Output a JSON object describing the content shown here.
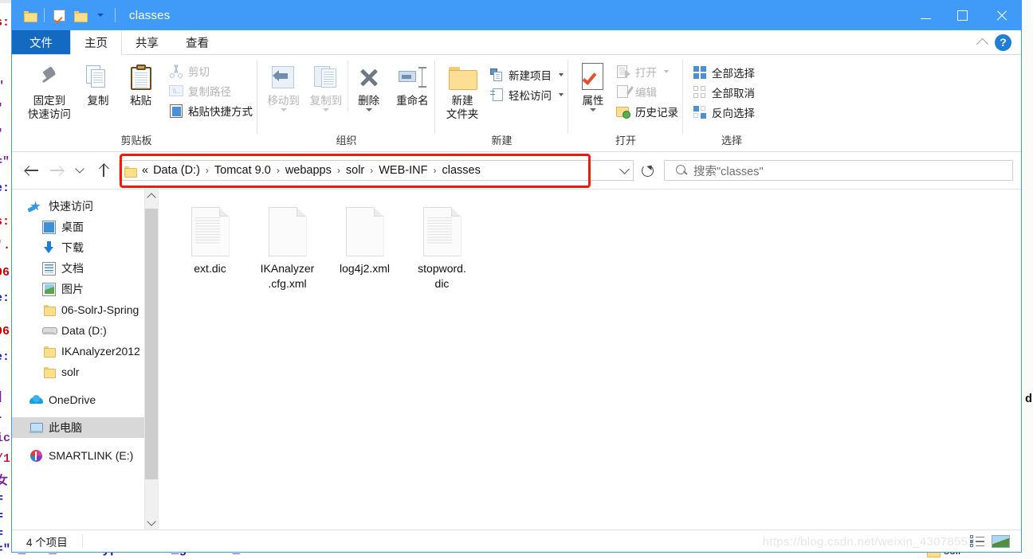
{
  "window": {
    "title": "classes",
    "quick_access_icons": [
      "folder-icon",
      "properties-check-icon",
      "folder-icon"
    ],
    "dropdown_caret": "chevron-down-icon",
    "minimize": "minimize-icon",
    "maximize": "maximize-icon",
    "close": "close-icon"
  },
  "ribbon": {
    "tabs": [
      {
        "label": "文件",
        "type": "file"
      },
      {
        "label": "主页",
        "type": "active"
      },
      {
        "label": "共享",
        "type": "normal"
      },
      {
        "label": "查看",
        "type": "normal"
      }
    ],
    "collapse_icon": "chevron-up-icon",
    "help_icon": "question-mark-icon",
    "groups": [
      {
        "label": "剪贴板",
        "big_buttons": [
          {
            "label": "固定到\n快速访问",
            "line1": "固定到",
            "line2": "快速访问",
            "icon": "pin-icon"
          },
          {
            "label": "复制",
            "line1": "复制",
            "line2": "",
            "icon": "copy-icon"
          },
          {
            "label": "粘贴",
            "line1": "粘贴",
            "line2": "",
            "icon": "paste-clipboard-icon"
          }
        ],
        "small_buttons": [
          {
            "label": "剪切",
            "icon": "scissors-icon",
            "disabled": true
          },
          {
            "label": "复制路径",
            "icon": "copy-path-icon",
            "disabled": true
          },
          {
            "label": "粘贴快捷方式",
            "icon": "paste-shortcut-icon",
            "disabled": false
          }
        ]
      },
      {
        "label": "组织",
        "big_buttons": [
          {
            "line1": "移动到",
            "line2": "",
            "icon": "move-to-icon",
            "disabled": true,
            "caret": true
          },
          {
            "line1": "复制到",
            "line2": "",
            "icon": "copy-to-icon",
            "disabled": true,
            "caret": true
          },
          {
            "line1": "删除",
            "line2": "",
            "icon": "delete-x-icon",
            "disabled": false,
            "caret": true
          },
          {
            "line1": "重命名",
            "line2": "",
            "icon": "rename-icon",
            "disabled": false,
            "caret": false
          }
        ],
        "small_buttons": []
      },
      {
        "label": "新建",
        "big_buttons": [
          {
            "line1": "新建",
            "line2": "文件夹",
            "icon": "new-folder-icon"
          }
        ],
        "small_buttons": [
          {
            "label": "新建项目",
            "icon": "new-item-icon",
            "caret": true
          },
          {
            "label": "轻松访问",
            "icon": "easy-access-icon",
            "caret": true
          }
        ]
      },
      {
        "label": "打开",
        "big_buttons": [
          {
            "line1": "属性",
            "line2": "",
            "icon": "properties-icon",
            "caret": true
          }
        ],
        "small_buttons": [
          {
            "label": "打开",
            "icon": "open-icon",
            "disabled": true,
            "caret": true
          },
          {
            "label": "编辑",
            "icon": "edit-icon",
            "disabled": true
          },
          {
            "label": "历史记录",
            "icon": "history-icon",
            "disabled": false
          }
        ]
      },
      {
        "label": "选择",
        "big_buttons": [],
        "small_buttons": [
          {
            "label": "全部选择",
            "icon": "select-all-icon"
          },
          {
            "label": "全部取消",
            "icon": "select-none-icon"
          },
          {
            "label": "反向选择",
            "icon": "invert-selection-icon"
          }
        ]
      }
    ]
  },
  "addressbar": {
    "back_icon": "back-arrow-icon",
    "forward_icon": "forward-arrow-icon",
    "recent_icon": "chevron-down-icon",
    "up_icon": "up-arrow-icon",
    "leading": "«",
    "crumbs": [
      "Data (D:)",
      "Tomcat 9.0",
      "webapps",
      "solr",
      "WEB-INF",
      "classes"
    ],
    "separator": "›",
    "dropdown_icon": "chevron-down-icon",
    "refresh_icon": "refresh-icon",
    "highlight_color": "#f4180f"
  },
  "search": {
    "icon": "search-icon",
    "placeholder": "搜索\"classes\""
  },
  "navpane": {
    "items": [
      {
        "label": "快速访问",
        "icon": "quick-access-star-icon",
        "indent": 0,
        "pinned": false,
        "selected": false
      },
      {
        "label": "桌面",
        "icon": "desktop-icon",
        "indent": 1,
        "pinned": true,
        "selected": false
      },
      {
        "label": "下载",
        "icon": "downloads-icon",
        "indent": 1,
        "pinned": true,
        "selected": false
      },
      {
        "label": "文档",
        "icon": "documents-icon",
        "indent": 1,
        "pinned": true,
        "selected": false
      },
      {
        "label": "图片",
        "icon": "pictures-icon",
        "indent": 1,
        "pinned": true,
        "selected": false
      },
      {
        "label": "06-SolrJ-Spring",
        "icon": "folder-icon",
        "indent": 1,
        "pinned": false,
        "selected": false
      },
      {
        "label": "Data (D:)",
        "icon": "drive-icon",
        "indent": 1,
        "pinned": false,
        "selected": false
      },
      {
        "label": "IKAnalyzer2012",
        "icon": "folder-icon",
        "indent": 1,
        "pinned": false,
        "selected": false
      },
      {
        "label": "solr",
        "icon": "folder-icon",
        "indent": 1,
        "pinned": false,
        "selected": false
      },
      {
        "label": "OneDrive",
        "icon": "onedrive-cloud-icon",
        "indent": 0,
        "pinned": false,
        "selected": false
      },
      {
        "label": "此电脑",
        "icon": "this-pc-icon",
        "indent": 0,
        "pinned": false,
        "selected": true
      },
      {
        "label": "SMARTLINK (E:)",
        "icon": "usb-drive-icon",
        "indent": 0,
        "pinned": false,
        "selected": false
      }
    ],
    "scrollbar": {
      "up_icon": "scroll-up-icon",
      "down_icon": "scroll-down-icon"
    }
  },
  "files": [
    {
      "name": "ext.dic",
      "icon": "text-file-icon",
      "lined": true
    },
    {
      "name": "IKAnalyzer.cfg.xml",
      "line1": "IKAnalyzer",
      "line2": ".cfg.xml",
      "icon": "xml-file-icon",
      "lined": false
    },
    {
      "name": "log4j2.xml",
      "line1": "log4j2.xml",
      "line2": "",
      "icon": "xml-file-icon",
      "lined": false
    },
    {
      "name": "stopword.dic",
      "line1": "stopword.",
      "line2": "dic",
      "icon": "text-file-icon",
      "lined": true
    }
  ],
  "statusbar": {
    "count_text": "4 个项目",
    "view_details_icon": "details-view-icon",
    "view_thumbnails_icon": "thumbnails-view-icon"
  },
  "watermark": "https://blog.csdn.net/weixin_43078552",
  "background_code": {
    "bottom_line": "=\"*_txt_rev\" type=\"text_general_rev\"",
    "right_label": "d",
    "folder_label": "solr"
  }
}
